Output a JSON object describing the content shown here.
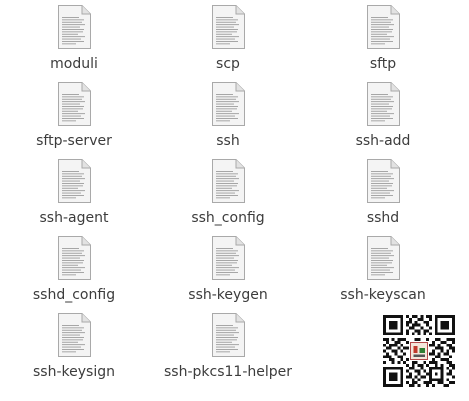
{
  "files": [
    {
      "name": "moduli"
    },
    {
      "name": "scp"
    },
    {
      "name": "sftp"
    },
    {
      "name": "sftp-server"
    },
    {
      "name": "ssh"
    },
    {
      "name": "ssh-add"
    },
    {
      "name": "ssh-agent"
    },
    {
      "name": "ssh_config"
    },
    {
      "name": "sshd"
    },
    {
      "name": "sshd_config"
    },
    {
      "name": "ssh-keygen"
    },
    {
      "name": "ssh-keyscan"
    },
    {
      "name": "ssh-keysign"
    },
    {
      "name": "ssh-pkcs11-helper"
    }
  ],
  "icons": {
    "file": "text-document-icon",
    "overlay": "qr-code-icon"
  },
  "colors": {
    "label_text": "#3c3c3c",
    "page_background": "#ffffff",
    "document_paper": "#f4f4f4",
    "document_border": "#a9a9a9",
    "document_lines": "#9d9d9d"
  }
}
